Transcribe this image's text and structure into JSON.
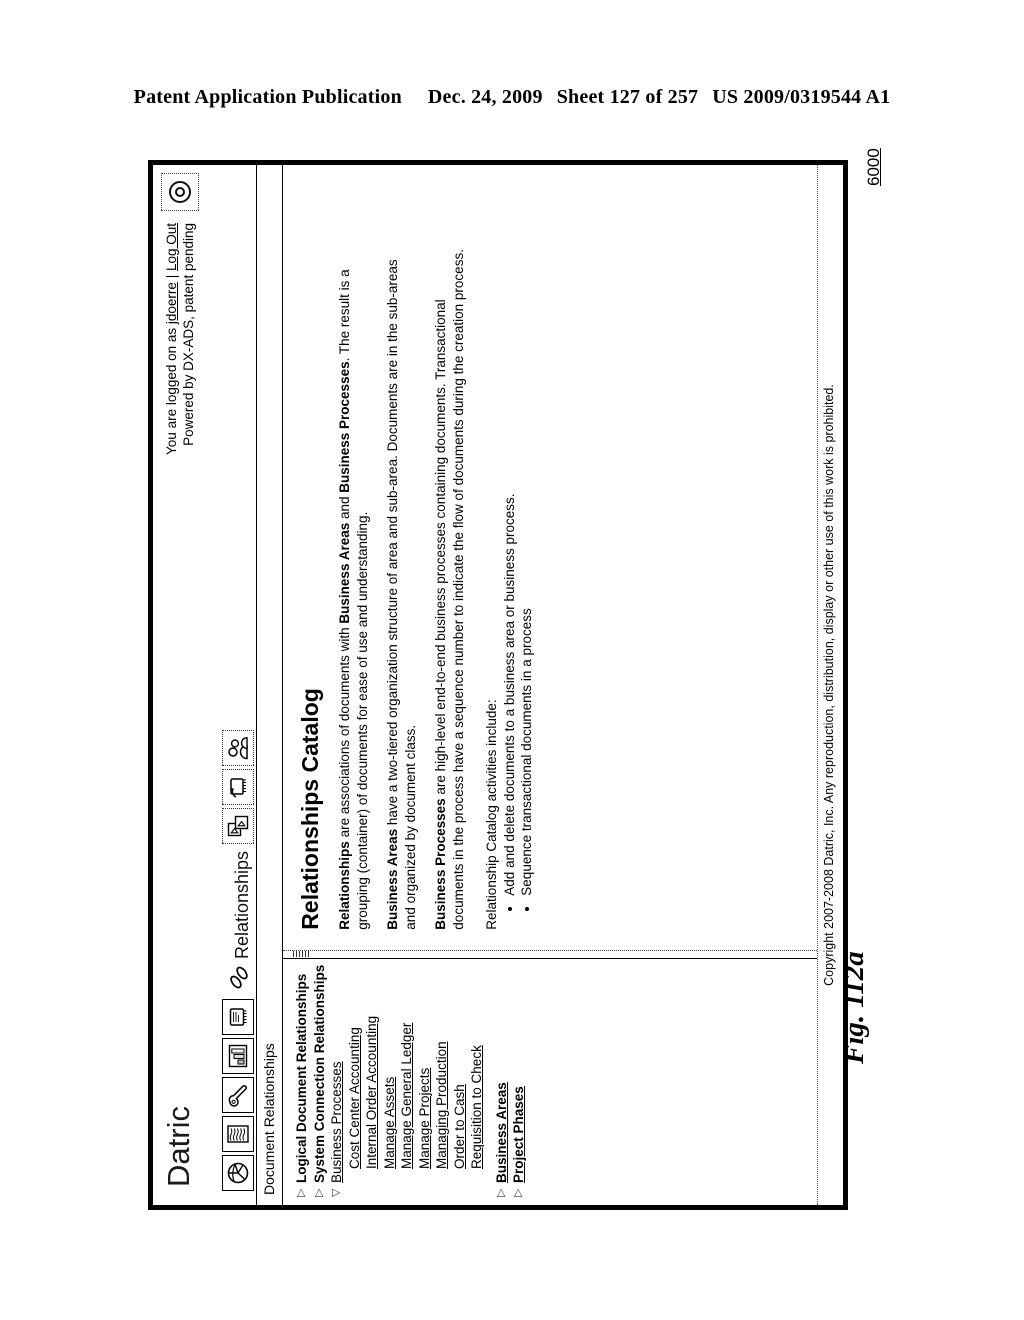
{
  "patent_header": {
    "publication": "Patent Application Publication",
    "date": "Dec. 24, 2009",
    "sheet": "Sheet 127 of 257",
    "number": "US 2009/0319544 A1"
  },
  "figure": {
    "label": "Fig. 112a",
    "reference_numeral": "6000"
  },
  "app": {
    "brand": "Datric",
    "login_line1_prefix": "You are logged on as ",
    "login_user": "jdoerre",
    "login_separator": " | ",
    "login_logout": "Log Out",
    "login_line2": "Powered by DX-ADS, patent pending",
    "help_icon": "help-ring-icon",
    "toolbar": {
      "icons": [
        {
          "name": "globe-icon",
          "label": ""
        },
        {
          "name": "ledger-pages-icon",
          "label": ""
        },
        {
          "name": "wrench-tools-icon",
          "label": ""
        },
        {
          "name": "bar-chart-icon",
          "label": ""
        },
        {
          "name": "chip-icon",
          "label": ""
        }
      ],
      "active_label": "Relationships",
      "active_icon": "paperclip-link-icon",
      "trailing_icons": [
        {
          "name": "documents-windows-icon"
        },
        {
          "name": "chip-arrow-icon"
        },
        {
          "name": "users-group-icon"
        }
      ]
    },
    "tab_title": "Document Relationships"
  },
  "sidebar": {
    "items": [
      {
        "label": "Logical Document Relationships",
        "twisty": "▷",
        "style": "strong",
        "indent": 0
      },
      {
        "label": "System Connection Relationships",
        "twisty": "▷",
        "style": "strong",
        "indent": 0
      },
      {
        "label": "Business Processes",
        "twisty": "▽",
        "style": "link",
        "indent": 0
      },
      {
        "label": "Cost Center Accounting",
        "twisty": "",
        "style": "link",
        "indent": 1
      },
      {
        "label": "Internal Order Accounting",
        "twisty": "",
        "style": "link",
        "indent": 1
      },
      {
        "label": "Manage Assets",
        "twisty": "",
        "style": "link",
        "indent": 1
      },
      {
        "label": "Manage General Ledger",
        "twisty": "",
        "style": "link",
        "indent": 1
      },
      {
        "label": "Manage Projects",
        "twisty": "",
        "style": "link",
        "indent": 1
      },
      {
        "label": "Managing Production",
        "twisty": "",
        "style": "link",
        "indent": 1
      },
      {
        "label": "Order to Cash",
        "twisty": "",
        "style": "link",
        "indent": 1
      },
      {
        "label": "Requisition to Check",
        "twisty": "",
        "style": "link",
        "indent": 1
      },
      {
        "label": "Business Areas",
        "twisty": "▷",
        "style": "strong-link",
        "indent": 0,
        "gap_before": true
      },
      {
        "label": "Project Phases",
        "twisty": "▷",
        "style": "strong-link",
        "indent": 0
      }
    ]
  },
  "content": {
    "heading": "Relationships Catalog",
    "paragraphs": [
      {
        "lead": "Relationships",
        "rest": " are associations of documents with ",
        "lead2": "Business Areas",
        "mid": " and ",
        "lead3": "Business Processes",
        "tail": ". The result is a grouping (container) of documents for ease of use and understanding."
      },
      {
        "lead": "Business Areas",
        "tail": " have a two-tiered organization structure of area and sub-area. Documents are in the sub-areas and organized by document class."
      },
      {
        "lead": "Business Processes",
        "tail": " are high-level end-to-end business processes containing documents. Transactional documents in the process have a sequence number to indicate the flow of documents during the creation process."
      }
    ],
    "activities_intro": "Relationship Catalog activities include:",
    "activities": [
      "Add and delete documents to a business area or business process.",
      "Sequence transactional documents in a process"
    ]
  },
  "footer": {
    "copyright": "Copyright 2007-2008 Datric, Inc.  Any reproduction, distribution, display or other use of this work is prohibited."
  }
}
